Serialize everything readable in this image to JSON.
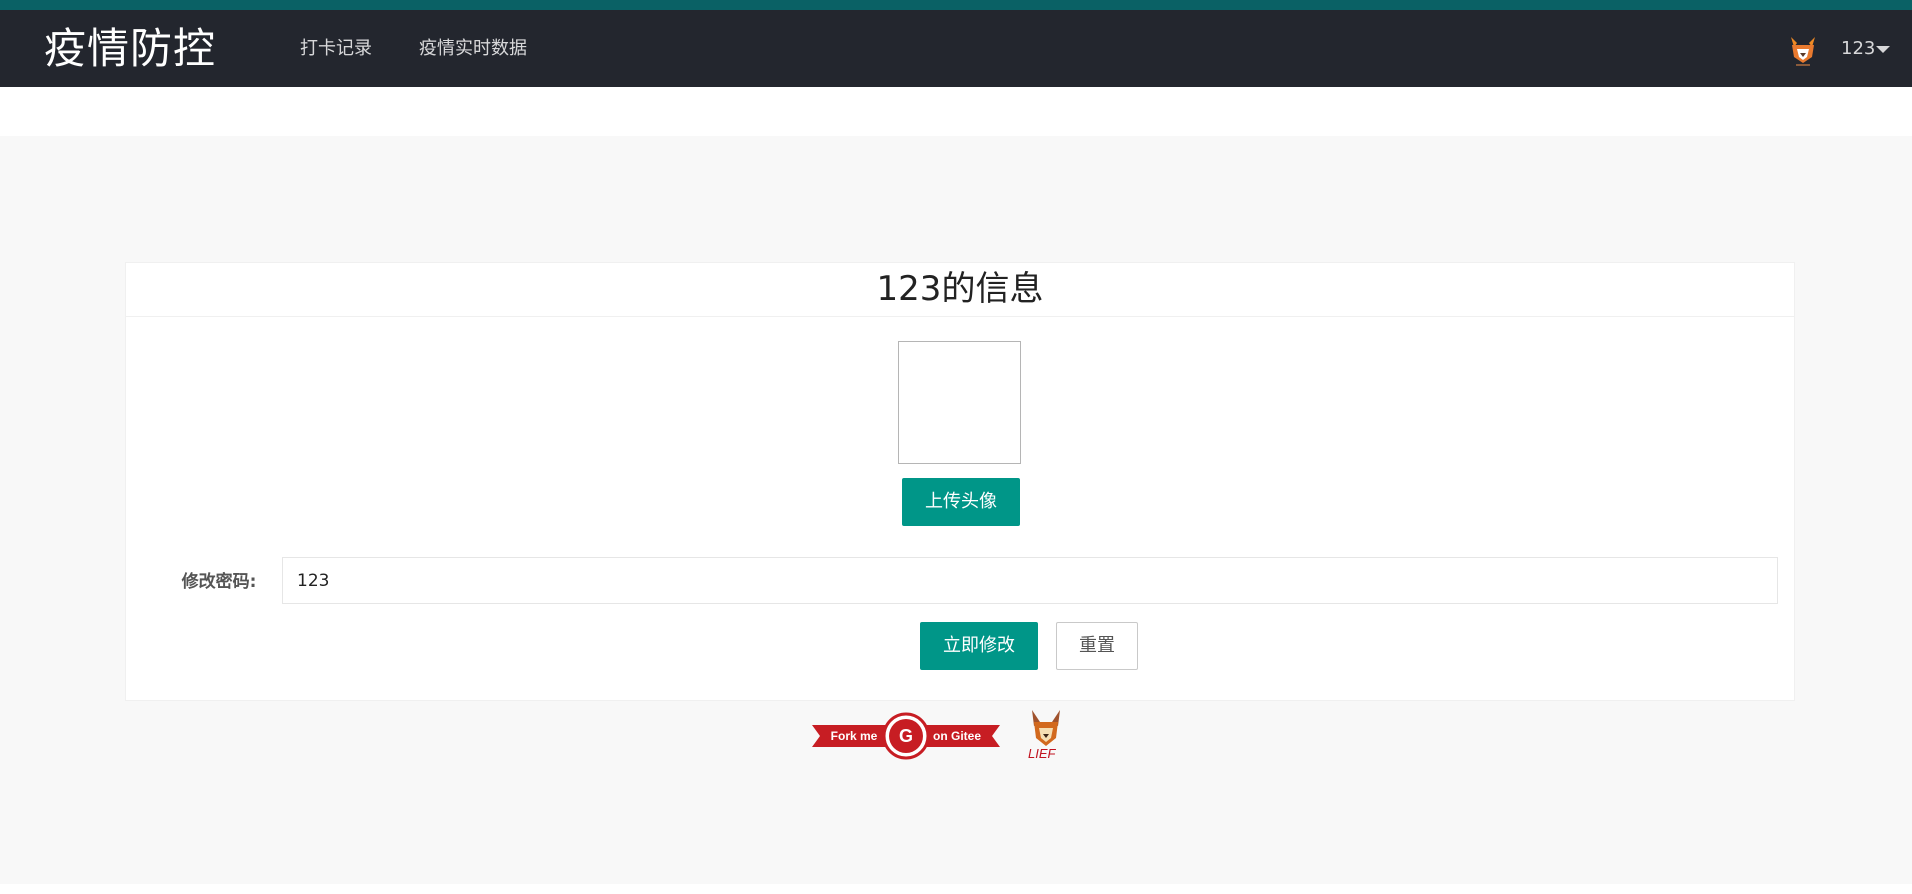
{
  "header": {
    "logo": "疫情防控",
    "nav": [
      {
        "label": "打卡记录"
      },
      {
        "label": "疫情实时数据"
      }
    ],
    "user": {
      "name": "123",
      "avatar_icon": "fox-avatar-icon"
    }
  },
  "card": {
    "title": "123的信息",
    "upload_button": "上传头像",
    "password": {
      "label": "修改密码:",
      "value": "123"
    },
    "submit_button": "立即修改",
    "reset_button": "重置"
  },
  "footer": {
    "gitee_badge": {
      "left": "Fork me",
      "right": "on Gitee",
      "letter": "G"
    },
    "lief_logo": "LIEF"
  },
  "colors": {
    "header_bg": "#23262e",
    "top_strip": "#0a6165",
    "primary": "#009688",
    "badge_red": "#c71d23"
  }
}
